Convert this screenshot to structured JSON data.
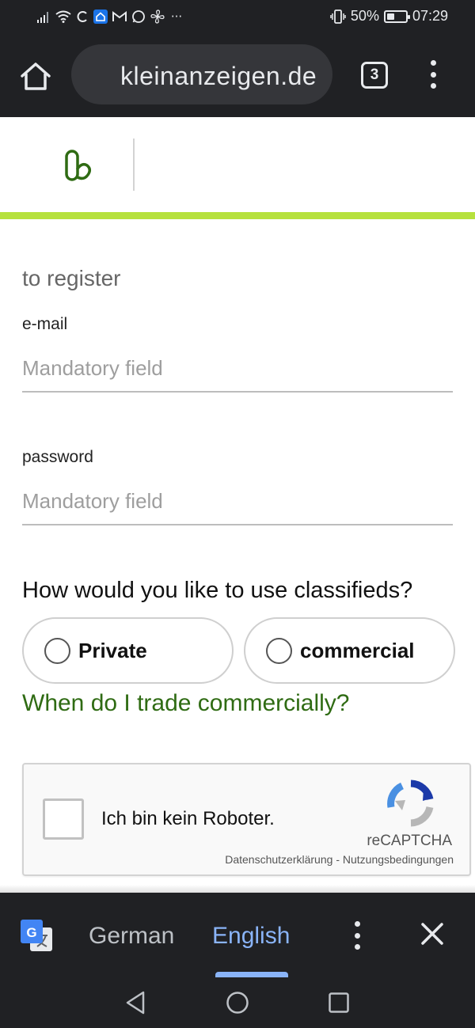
{
  "status_bar": {
    "battery_percent": "50%",
    "battery_level": 0.5,
    "time": "07:29",
    "left_icons": [
      "signal-icon",
      "wifi-icon",
      "sync-icon",
      "home-app-icon",
      "gmail-icon",
      "whatsapp-icon",
      "fan-icon",
      "more-notifications-icon"
    ]
  },
  "browser": {
    "url": "kleinanzeigen.de",
    "tab_count": "3"
  },
  "site": {
    "brand_color": "#2f6b13",
    "accent_bar_color": "#b6e13d"
  },
  "form": {
    "title": "to register",
    "email": {
      "label": "e-mail",
      "placeholder": "Mandatory field",
      "value": ""
    },
    "password": {
      "label": "password",
      "placeholder": "Mandatory field",
      "value": ""
    },
    "usage_question": "How would you like to use classifieds?",
    "options": [
      {
        "label": "Private",
        "selected": false
      },
      {
        "label": "commercial",
        "selected": false
      }
    ],
    "trade_link": "When do I trade commercially?"
  },
  "recaptcha": {
    "checkbox_label": "Ich bin kein Roboter.",
    "brand": "reCAPTCHA",
    "privacy": "Datenschutzerklärung",
    "separator": "-",
    "terms": "Nutzungsbedingungen",
    "checked": false
  },
  "translate_bar": {
    "source_language": "German",
    "target_language": "English",
    "active_language": "English",
    "active_color": "#8ab4f8"
  }
}
